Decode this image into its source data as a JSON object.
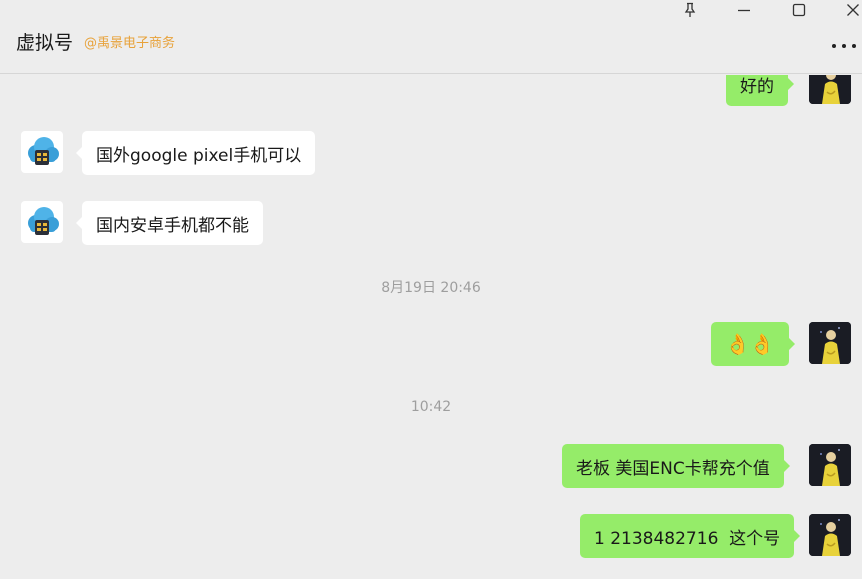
{
  "header": {
    "title": "虚拟号",
    "subtitle": "@禹景电子商务",
    "icons": [
      "pin-icon",
      "minimize-icon",
      "maximize-icon",
      "close-icon",
      "more-icon"
    ]
  },
  "messages": [
    {
      "side": "right",
      "type": "text",
      "text": "好的"
    },
    {
      "side": "left",
      "type": "text",
      "text": "国外google pixel手机可以"
    },
    {
      "side": "left",
      "type": "text",
      "text": "国内安卓手机都不能"
    },
    {
      "type": "timestamp",
      "text": "8月19日 20:46"
    },
    {
      "side": "right",
      "type": "emoji",
      "text": "👌👌"
    },
    {
      "type": "timestamp",
      "text": "10:42"
    },
    {
      "side": "right",
      "type": "text",
      "text": "老板 美国ENC卡帮充个值"
    },
    {
      "side": "right",
      "type": "text",
      "text": "1 2138482716  这个号"
    }
  ],
  "colors": {
    "background": "#ededed",
    "bubble_self": "#95ec69",
    "bubble_other": "#ffffff",
    "subtitle": "#e8a23a",
    "timestamp": "#9e9e9e"
  }
}
